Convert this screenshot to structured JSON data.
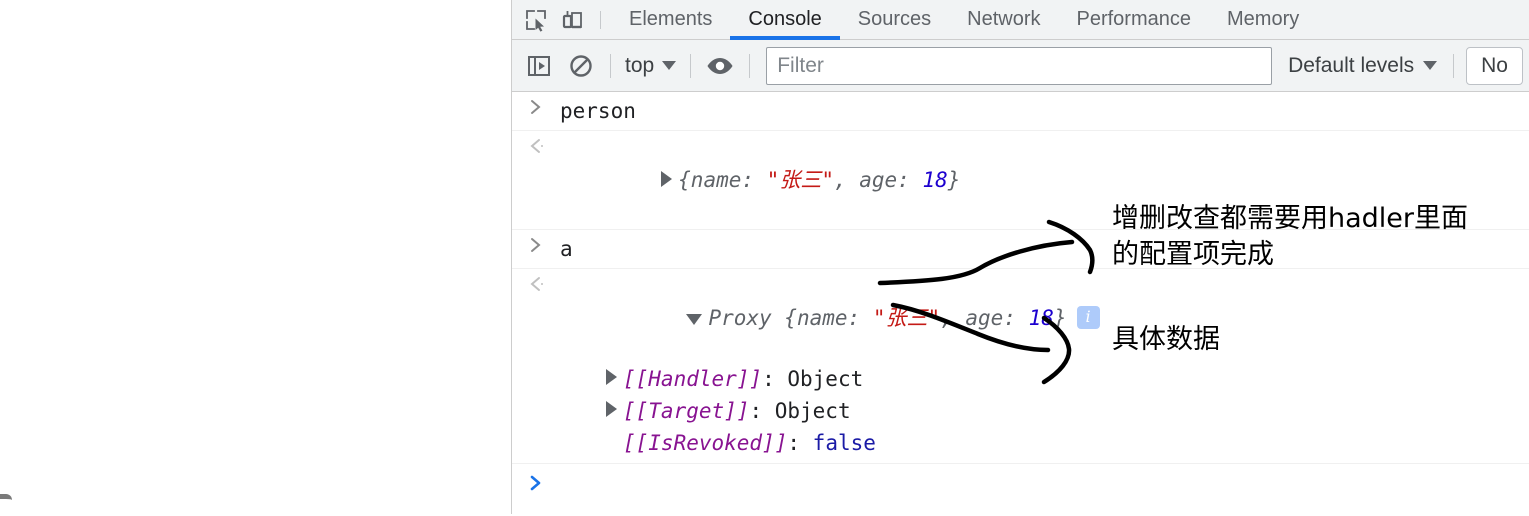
{
  "devtools": {
    "left_icons": [
      {
        "name": "inspect-element-icon",
        "label": "Inspect element"
      },
      {
        "name": "device-toolbar-icon",
        "label": "Toggle device toolbar"
      }
    ],
    "tabs": [
      {
        "label": "Elements",
        "active": false
      },
      {
        "label": "Console",
        "active": true
      },
      {
        "label": "Sources",
        "active": false
      },
      {
        "label": "Network",
        "active": false
      },
      {
        "label": "Performance",
        "active": false
      },
      {
        "label": "Memory",
        "active": false
      }
    ],
    "active_tab_underline_color": "#1a73e8",
    "toolbar": {
      "sidebar_toggle_icon": "show-console-sidebar-icon",
      "clear_icon": "clear-console-icon",
      "context_label": "top",
      "eye_icon": "create-live-expression-icon",
      "filter_placeholder": "Filter",
      "filter_value": "",
      "levels_label": "Default levels",
      "issues_label": "No"
    }
  },
  "console": {
    "messages": [
      {
        "kind": "input",
        "gutter": "input-chevron",
        "text": "person"
      },
      {
        "kind": "output",
        "gutter": "output-chevron",
        "disclosure": "collapsed",
        "tokens": [
          {
            "t": "{name: ",
            "c": "gray"
          },
          {
            "t": "\"张三\"",
            "c": "string"
          },
          {
            "t": ", age: ",
            "c": "gray"
          },
          {
            "t": "18",
            "c": "num"
          },
          {
            "t": "}",
            "c": "gray"
          }
        ]
      },
      {
        "kind": "input",
        "gutter": "input-chevron",
        "text": "a"
      },
      {
        "kind": "output",
        "gutter": "output-chevron",
        "disclosure": "expanded",
        "tokens": [
          {
            "t": "Proxy ",
            "c": "gray"
          },
          {
            "t": "{name: ",
            "c": "gray"
          },
          {
            "t": "\"张三\"",
            "c": "string"
          },
          {
            "t": ", age: ",
            "c": "gray"
          },
          {
            "t": "18",
            "c": "num"
          },
          {
            "t": "}",
            "c": "gray"
          }
        ],
        "badge": "i",
        "children": [
          {
            "disclosure": "collapsed",
            "key": "[[Handler]]",
            "sep": ": ",
            "value": "Object",
            "value_kind": "object"
          },
          {
            "disclosure": "collapsed",
            "key": "[[Target]]",
            "sep": ": ",
            "value": "Object",
            "value_kind": "object"
          },
          {
            "disclosure": "none",
            "key": "[[IsRevoked]]",
            "sep": ": ",
            "value": "false",
            "value_kind": "boolean"
          }
        ]
      }
    ],
    "prompt": {
      "chevron": "❯",
      "value": ""
    }
  },
  "annotations": {
    "note_1": "增删改查都需要用hadler里面\n的配置项完成",
    "note_2": "具体数据",
    "ink_color": "#000000"
  }
}
